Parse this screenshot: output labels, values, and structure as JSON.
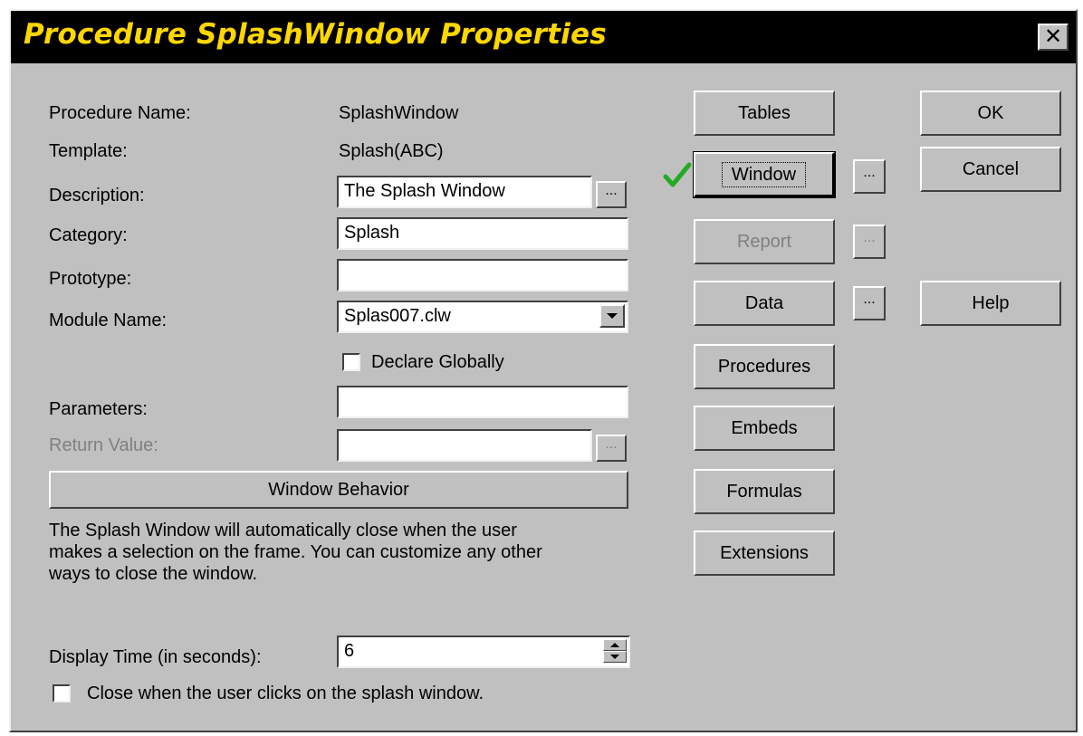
{
  "window": {
    "title": "Procedure SplashWindow Properties",
    "close_glyph": "✕"
  },
  "fields": {
    "procedure_name_label": "Procedure Name:",
    "procedure_name_value": "SplashWindow",
    "template_label": "Template:",
    "template_value": "Splash(ABC)",
    "description_label": "Description:",
    "description_value": "The Splash Window",
    "category_label": "Category:",
    "category_value": "Splash",
    "prototype_label": "Prototype:",
    "prototype_value": "",
    "module_name_label": "Module Name:",
    "module_name_value": "Splas007.clw",
    "declare_globally_label": "Declare Globally",
    "declare_globally_checked": false,
    "parameters_label": "Parameters:",
    "parameters_value": "",
    "return_value_label": "Return Value:",
    "return_value_value": "",
    "ellipsis": "..."
  },
  "behavior": {
    "button_label": "Window Behavior",
    "description": "The Splash Window will automatically close when the user makes a selection on the frame. You can customize any other ways to close the window.",
    "display_time_label": "Display Time (in seconds):",
    "display_time_value": "6",
    "close_on_click_label": "Close when the user clicks on the splash window.",
    "close_on_click_checked": false
  },
  "buttons": {
    "tables": "Tables",
    "window": "Window",
    "report": "Report",
    "data": "Data",
    "procedures": "Procedures",
    "embeds": "Embeds",
    "formulas": "Formulas",
    "extensions": "Extensions",
    "ok": "OK",
    "cancel": "Cancel",
    "help": "Help"
  },
  "icons": {
    "window_checkmark": "checkmark-icon",
    "checkmark_color": "#22aa22"
  },
  "colors": {
    "title_text": "#ffd700",
    "title_bg": "#000000",
    "dialog_bg": "#c0c0c0"
  }
}
